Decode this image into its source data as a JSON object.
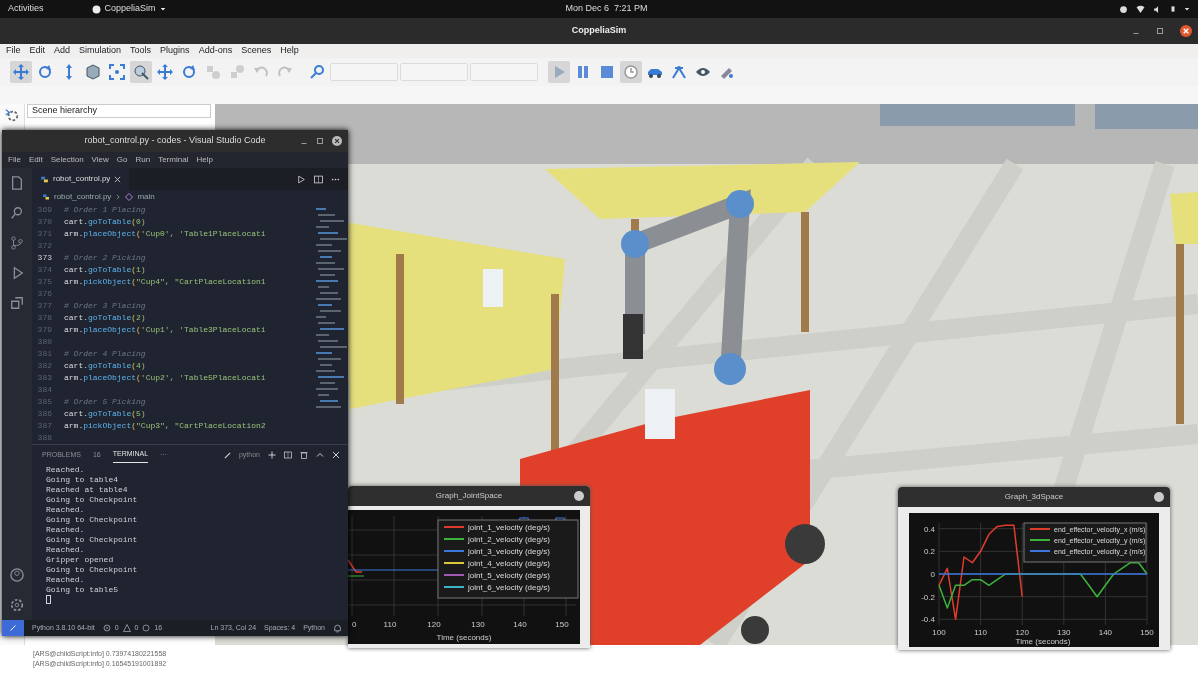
{
  "top_bar": {
    "activities": "Activities",
    "app_menu": "CoppeliaSim",
    "clock": "Mon Dec 6  7:21 PM"
  },
  "coppelia": {
    "title": "CoppeliaSim",
    "menu": [
      "File",
      "Edit",
      "Add",
      "Simulation",
      "Tools",
      "Plugins",
      "Add-ons",
      "Scenes",
      "Help"
    ],
    "toolbar": [
      {
        "kind": "button",
        "selected": true,
        "disabled": false
      },
      {
        "kind": "button",
        "selected": false,
        "disabled": false
      },
      {
        "kind": "button",
        "selected": false,
        "disabled": false
      },
      {
        "kind": "button",
        "selected": false,
        "disabled": false
      },
      {
        "kind": "button",
        "selected": false,
        "disabled": false
      },
      {
        "kind": "button",
        "selected": true,
        "disabled": false
      },
      {
        "kind": "button",
        "selected": false,
        "disabled": false
      },
      {
        "kind": "button",
        "selected": false,
        "disabled": false
      },
      {
        "kind": "button",
        "selected": false,
        "disabled": true
      },
      {
        "kind": "button",
        "selected": false,
        "disabled": true
      },
      {
        "kind": "button",
        "selected": false,
        "disabled": true
      },
      {
        "kind": "button",
        "selected": false,
        "disabled": true
      },
      {
        "kind": "button",
        "selected": false,
        "disabled": false
      },
      {
        "kind": "dropdown",
        "disabled": true
      },
      {
        "kind": "dropdown",
        "disabled": true
      },
      {
        "kind": "dropdown",
        "disabled": true
      },
      {
        "kind": "button",
        "selected": true,
        "disabled": false
      },
      {
        "kind": "button",
        "selected": false,
        "disabled": false
      },
      {
        "kind": "button",
        "selected": false,
        "disabled": false
      },
      {
        "kind": "button",
        "selected": true,
        "disabled": false
      },
      {
        "kind": "button",
        "selected": false,
        "disabled": false
      },
      {
        "kind": "button",
        "selected": false,
        "disabled": false
      },
      {
        "kind": "button",
        "selected": false,
        "disabled": false
      },
      {
        "kind": "button",
        "selected": false,
        "disabled": false
      }
    ],
    "hierarchy_title": "Scene hierarchy",
    "console": [
      "[ARS@childScript:info] 0.73974180221558",
      "[ARS@childScript:info] 0.16545191001892"
    ]
  },
  "vscode": {
    "title": "robot_control.py - codes - Visual Studio Code",
    "menu": [
      "File",
      "Edit",
      "Selection",
      "View",
      "Go",
      "Run",
      "Terminal",
      "Help"
    ],
    "tab": "robot_control.py",
    "breadcrumb": [
      "robot_control.py",
      "main"
    ],
    "code": [
      {
        "number": "369",
        "kind": "comment",
        "text": "# Order 1 Placing",
        "current": false
      },
      {
        "number": "370",
        "kind": "code",
        "text": "cart.goToTable(0)",
        "current": false
      },
      {
        "number": "371",
        "kind": "code",
        "text": "arm.placeObject('Cup0', 'Table1PlaceLocati",
        "current": false
      },
      {
        "number": "372",
        "kind": "blank",
        "current": false
      },
      {
        "number": "373",
        "kind": "comment",
        "text": "# Order 2 Picking",
        "current": true
      },
      {
        "number": "374",
        "kind": "code",
        "text": "cart.goToTable(1)",
        "current": false
      },
      {
        "number": "375",
        "kind": "code",
        "text": "arm.pickObject(\"Cup4\", \"CartPlaceLocation1",
        "current": false
      },
      {
        "number": "376",
        "kind": "blank",
        "current": false
      },
      {
        "number": "377",
        "kind": "comment",
        "text": "# Order 3 Placing",
        "current": false
      },
      {
        "number": "378",
        "kind": "code",
        "text": "cart.goToTable(2)",
        "current": false
      },
      {
        "number": "379",
        "kind": "code",
        "text": "arm.placeObject('Cup1', 'Table3PlaceLocati",
        "current": false
      },
      {
        "number": "380",
        "kind": "blank",
        "current": false
      },
      {
        "number": "381",
        "kind": "comment",
        "text": "# Order 4 Placing",
        "current": false
      },
      {
        "number": "382",
        "kind": "code",
        "text": "cart.goToTable(4)",
        "current": false
      },
      {
        "number": "383",
        "kind": "code",
        "text": "arm.placeObject('Cup2', 'Table5PlaceLocati",
        "current": false
      },
      {
        "number": "384",
        "kind": "blank",
        "current": false
      },
      {
        "number": "385",
        "kind": "comment",
        "text": "# Order 5 Picking",
        "current": false
      },
      {
        "number": "386",
        "kind": "code",
        "text": "cart.goToTable(5)",
        "current": false
      },
      {
        "number": "387",
        "kind": "code",
        "text": "arm.pickObject(\"Cup3\", \"CartPlaceLocation2",
        "current": false
      },
      {
        "number": "388",
        "kind": "blank",
        "current": false
      }
    ],
    "panel_tabs": [
      {
        "label": "PROBLEMS",
        "badge": "16",
        "selected": false
      },
      {
        "label": "TERMINAL",
        "selected": true
      }
    ],
    "panel_more": "···",
    "shell": "python",
    "terminal": [
      "Reached.",
      "Going to table4",
      "Reached at table4",
      "Going to Checkpoint",
      "Reached.",
      "Going to Checkpoint",
      "Reached.",
      "Going to Checkpoint",
      "Reached.",
      "Gripper opened",
      "Going to Checkpoint",
      "Reached.",
      "Going to table5"
    ],
    "status": {
      "interpreter": "Python 3.8.10 64-bit",
      "errors": "0",
      "warnings": "0",
      "infos": "16",
      "position": "Ln 373, Col 24",
      "spaces": "Spaces: 4",
      "language": "Python"
    }
  },
  "graph_joint": {
    "title": "Graph_JointSpace",
    "xtick_labels": [
      "0",
      "110",
      "120",
      "130",
      "140",
      "150"
    ],
    "xlabel": "Time (seconds)",
    "legend": [
      {
        "label": "joint_1_velocity (deg/s)",
        "color": "#e03c2c"
      },
      {
        "label": "joint_2_velocity (deg/s)",
        "color": "#3cb43c"
      },
      {
        "label": "joint_3_velocity (deg/s)",
        "color": "#3c78dc"
      },
      {
        "label": "joint_4_velocity (deg/s)",
        "color": "#d8c83c"
      },
      {
        "label": "joint_5_velocity (deg/s)",
        "color": "#a05ab4"
      },
      {
        "label": "joint_6_velocity (deg/s)",
        "color": "#3cb4c8"
      }
    ]
  },
  "graph_3d": {
    "title": "Graph_3dSpace",
    "chart_data": {
      "type": "line",
      "xlabel": "Time (seconds)",
      "x": [
        100,
        102,
        104,
        106,
        108,
        110,
        112,
        114,
        116,
        118,
        120,
        122,
        124,
        126,
        128,
        130,
        132,
        134,
        136,
        138,
        140,
        142,
        144,
        146,
        148,
        150
      ],
      "grid": true,
      "legend": "upper right",
      "xlim": [
        100,
        150
      ],
      "ylim": [
        -0.45,
        0.45
      ],
      "xticks": [
        100,
        110,
        120,
        130,
        140,
        150
      ],
      "yticks": [
        -0.4,
        -0.2,
        0,
        0.2,
        0.4
      ],
      "series": [
        {
          "name": "end_effector_velocity_x (m/s)",
          "color": "#e03c2c",
          "values": [
            -0.1,
            0.05,
            -0.4,
            0.15,
            0.1,
            0.2,
            0.35,
            0.42,
            0.43,
            0.43,
            -0.2,
            null,
            null,
            null,
            null,
            null,
            null,
            null,
            null,
            null,
            null,
            null,
            null,
            null,
            null,
            null
          ]
        },
        {
          "name": "end_effector_velocity_y (m/s)",
          "color": "#3cb43c",
          "values": [
            -0.1,
            -0.3,
            -0.1,
            -0.1,
            -0.05,
            -0.05,
            -0.1,
            -0.05,
            0,
            0,
            0,
            0,
            0,
            0,
            0,
            0,
            0,
            0,
            -0.1,
            -0.2,
            -0.1,
            0,
            0.05,
            0.1,
            0.1,
            0
          ]
        },
        {
          "name": "end_effector_velocity_z (m/s)",
          "color": "#3c78dc",
          "values": [
            0,
            0,
            0,
            0,
            0,
            0,
            0,
            0,
            0,
            0,
            0,
            0,
            0,
            0,
            0,
            0,
            0,
            0,
            0,
            0,
            0,
            0,
            0,
            0,
            0,
            0
          ]
        }
      ]
    }
  }
}
